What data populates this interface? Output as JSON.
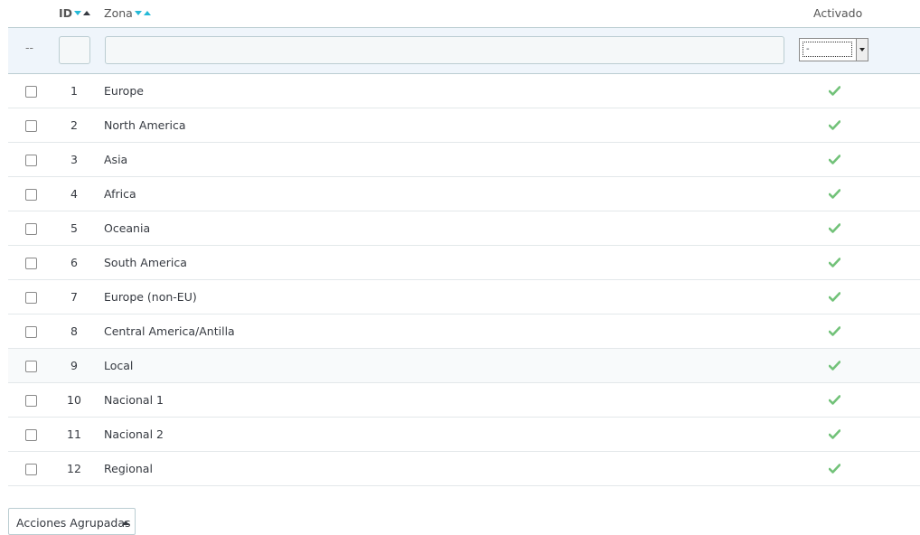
{
  "header": {
    "id_label": "ID",
    "zona_label": "Zona",
    "activado_label": "Activado"
  },
  "filter": {
    "dash": "--",
    "id_value": "",
    "zona_value": "",
    "activado_selected": "-"
  },
  "rows": [
    {
      "id": "1",
      "zona": "Europe",
      "activado": true
    },
    {
      "id": "2",
      "zona": "North America",
      "activado": true
    },
    {
      "id": "3",
      "zona": "Asia",
      "activado": true
    },
    {
      "id": "4",
      "zona": "Africa",
      "activado": true
    },
    {
      "id": "5",
      "zona": "Oceania",
      "activado": true
    },
    {
      "id": "6",
      "zona": "South America",
      "activado": true
    },
    {
      "id": "7",
      "zona": "Europe (non-EU)",
      "activado": true
    },
    {
      "id": "8",
      "zona": "Central America/Antilla",
      "activado": true
    },
    {
      "id": "9",
      "zona": "Local",
      "activado": true
    },
    {
      "id": "10",
      "zona": "Nacional 1",
      "activado": true
    },
    {
      "id": "11",
      "zona": "Nacional 2",
      "activado": true
    },
    {
      "id": "12",
      "zona": "Regional",
      "activado": true
    }
  ],
  "bulk_actions_label": "Acciones Agrupadas",
  "colors": {
    "accent": "#25b9d7",
    "check": "#72c279",
    "filter_bg": "#eff5fb"
  }
}
